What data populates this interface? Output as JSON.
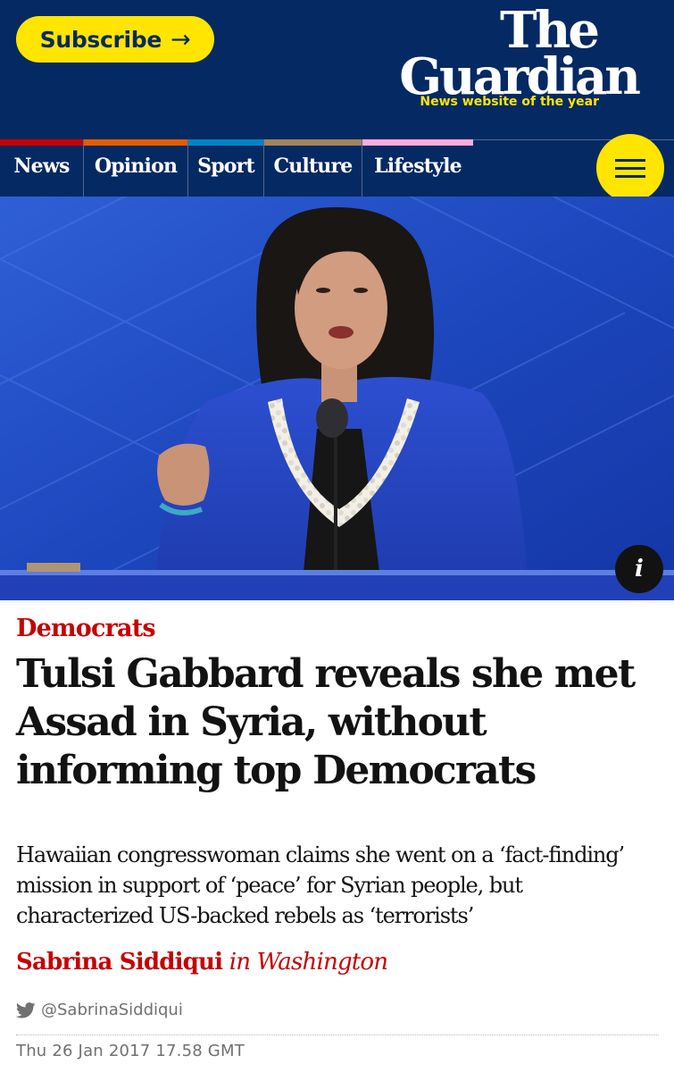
{
  "header": {
    "subscribe_label": "Subscribe",
    "subscribe_icon": "arrow-right-icon",
    "logo_line1": "The",
    "logo_line2": "Guardian",
    "tagline": "News website of the year",
    "menu_icon": "hamburger-menu-icon"
  },
  "nav": {
    "items": [
      {
        "label": "News",
        "color": "#c70000"
      },
      {
        "label": "Opinion",
        "color": "#e05e00"
      },
      {
        "label": "Sport",
        "color": "#0084c6"
      },
      {
        "label": "Culture",
        "color": "#a1845c"
      },
      {
        "label": "Lifestyle",
        "color": "#ffabdb"
      }
    ]
  },
  "hero": {
    "info_label": "i",
    "info_icon": "info-icon"
  },
  "article": {
    "kicker": "Democrats",
    "headline": "Tulsi Gabbard reveals she met Assad in Syria, without informing top Democrats",
    "standfirst": "Hawaiian congresswoman claims she went on a ‘fact-finding’ mission in support of ‘peace’ for Syrian people, but characterized US-backed rebels as ‘terrorists’",
    "byline_author": "Sabrina Siddiqui",
    "byline_location": "in Washington",
    "twitter_handle": "@SabrinaSiddiqui",
    "twitter_icon": "twitter-bird-icon",
    "dateline": "Thu 26 Jan 2017 17.58 GMT"
  },
  "colors": {
    "brand_blue": "#052962",
    "brand_yellow": "#ffe500",
    "news_red": "#c70000"
  }
}
